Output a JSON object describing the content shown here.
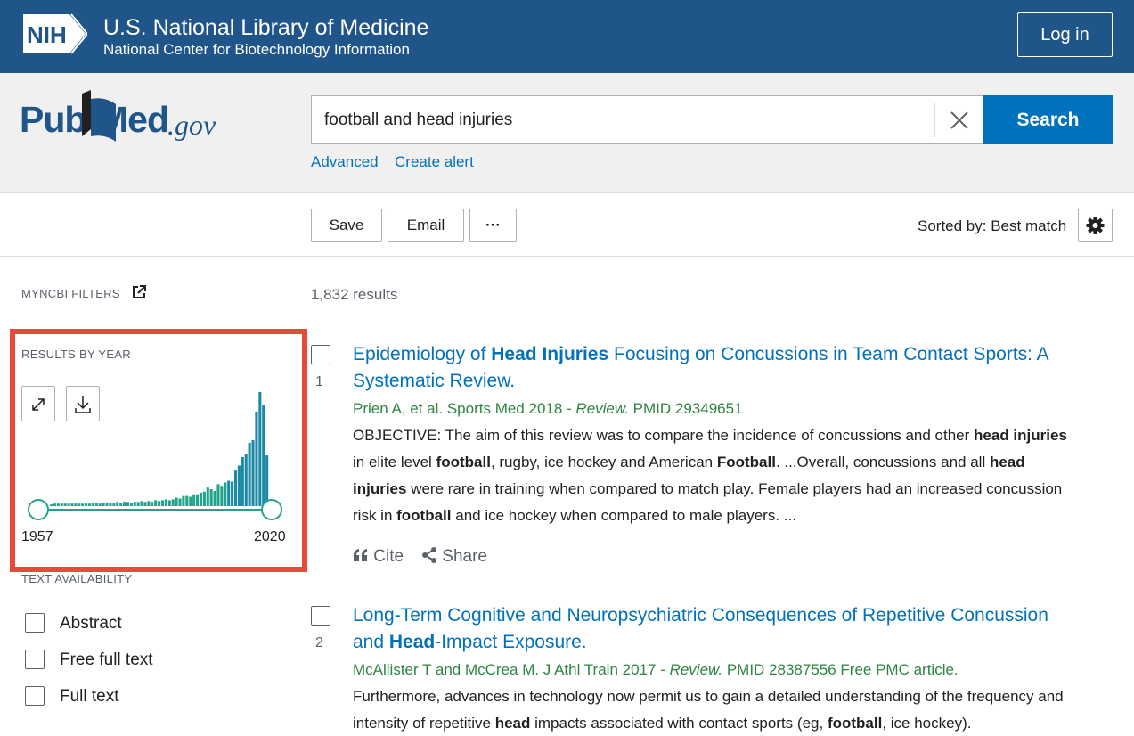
{
  "nih": {
    "badge": "NIH",
    "title": "U.S. National Library of Medicine",
    "subtitle": "National Center for Biotechnology Information",
    "login": "Log in"
  },
  "logo": {
    "pub": "Pub",
    "med": "Med",
    "gov": ".gov"
  },
  "search": {
    "value": "football and head injuries",
    "button": "Search",
    "links": [
      "Advanced",
      "Create alert"
    ]
  },
  "toolbar": {
    "save": "Save",
    "email": "Email",
    "more": "···",
    "sorted": "Sorted by: Best match"
  },
  "sidebar": {
    "myncbi_filters": "MYNCBI FILTERS",
    "results_by_year": "RESULTS BY YEAR",
    "year_start": "1957",
    "year_end": "2020",
    "text_availability": "TEXT AVAILABILITY",
    "filters": [
      "Abstract",
      "Free full text",
      "Full text"
    ]
  },
  "chart_data": {
    "type": "bar",
    "color": "#20a58c",
    "x_start": "1957",
    "x_end": "2020",
    "values": [
      2,
      3,
      3,
      3,
      3,
      3,
      3,
      3,
      3,
      3,
      3,
      3,
      4,
      4,
      3,
      4,
      4,
      4,
      4,
      5,
      4,
      5,
      5,
      4,
      5,
      5,
      6,
      5,
      6,
      5,
      7,
      6,
      7,
      8,
      7,
      8,
      10,
      9,
      12,
      12,
      11,
      14,
      14,
      16,
      17,
      22,
      20,
      18,
      26,
      24,
      28,
      30,
      29,
      42,
      48,
      58,
      62,
      75,
      78,
      112,
      135,
      120,
      60
    ]
  },
  "results": {
    "count": "1,832 results",
    "items": [
      {
        "num": "1",
        "title_parts": [
          "Epidemiology of ",
          "Head Injuries",
          " Focusing on Concussions in Team Contact Sports: A Systematic Review."
        ],
        "authors": "Prien A, et al. Sports Med 2018 - ",
        "review": "Review.",
        "pmid": " PMID 29349651",
        "snippet": [
          "OBJECTIVE: The aim of this review was to compare the incidence of concussions and other ",
          "head injuries",
          " in elite level ",
          "football",
          ", rugby, ice hockey and American ",
          "Football",
          ". ...Overall, concussions and all ",
          "head injuries",
          " were rare in training when compared to match play. Female players had an increased concussion risk in ",
          "football",
          " and ice hockey when compared to male players. ..."
        ],
        "cite": "Cite",
        "share": "Share"
      },
      {
        "num": "2",
        "title_parts": [
          "Long-Term Cognitive and Neuropsychiatric Consequences of Repetitive Concussion and ",
          "Head",
          "-Impact Exposure."
        ],
        "authors": "McAllister T and McCrea M. J Athl Train 2017 - ",
        "review": "Review.",
        "pmid": " PMID 28387556 Free PMC article.",
        "snippet": [
          "Furthermore, advances in technology now permit us to gain a detailed understanding of the frequency and intensity of repetitive ",
          "head",
          " impacts associated with contact sports (eg, ",
          "football",
          ", ice hockey)."
        ]
      }
    ]
  }
}
